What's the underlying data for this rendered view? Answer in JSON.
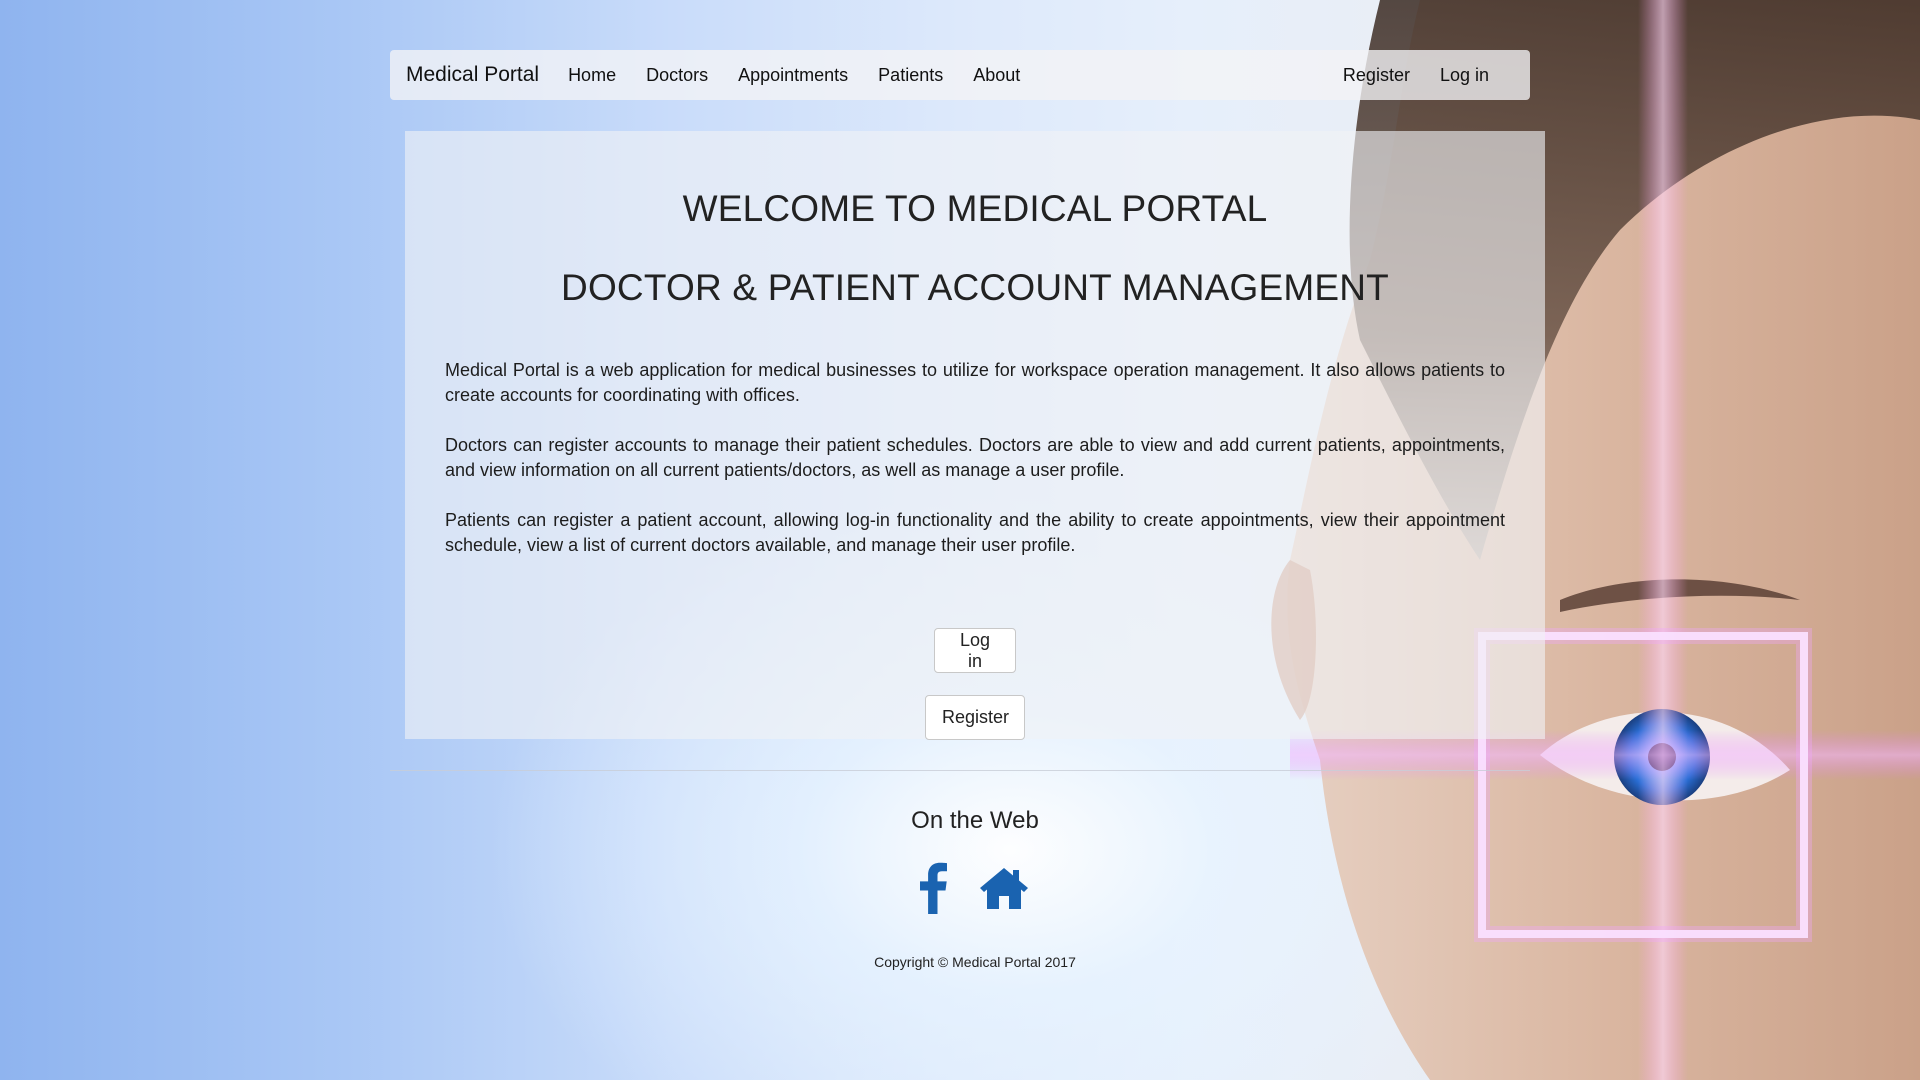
{
  "nav": {
    "brand": "Medical Portal",
    "links": [
      "Home",
      "Doctors",
      "Appointments",
      "Patients",
      "About"
    ],
    "right_links": [
      "Register",
      "Log in"
    ]
  },
  "main": {
    "title": "WELCOME TO MEDICAL PORTAL",
    "subtitle": "DOCTOR & PATIENT ACCOUNT MANAGEMENT",
    "paragraphs": [
      "Medical Portal is a web application for medical businesses to utilize for workspace operation management. It also allows patients to create accounts for coordinating with offices.",
      "Doctors can register accounts to manage their patient schedules. Doctors are able to view and add current patients, appointments, and view information on all current patients/doctors, as well as manage a user profile.",
      "Patients can register a patient account, allowing log-in functionality and the ability to create appointments, view their appointment schedule, view a list of current doctors available, and manage their user profile."
    ],
    "login_button": "Log in",
    "register_button": "Register"
  },
  "footer": {
    "heading": "On the Web",
    "icons": [
      "facebook-icon",
      "home-icon"
    ],
    "icon_color": "#1a63b0",
    "copyright": "Copyright © Medical Portal 2017"
  }
}
